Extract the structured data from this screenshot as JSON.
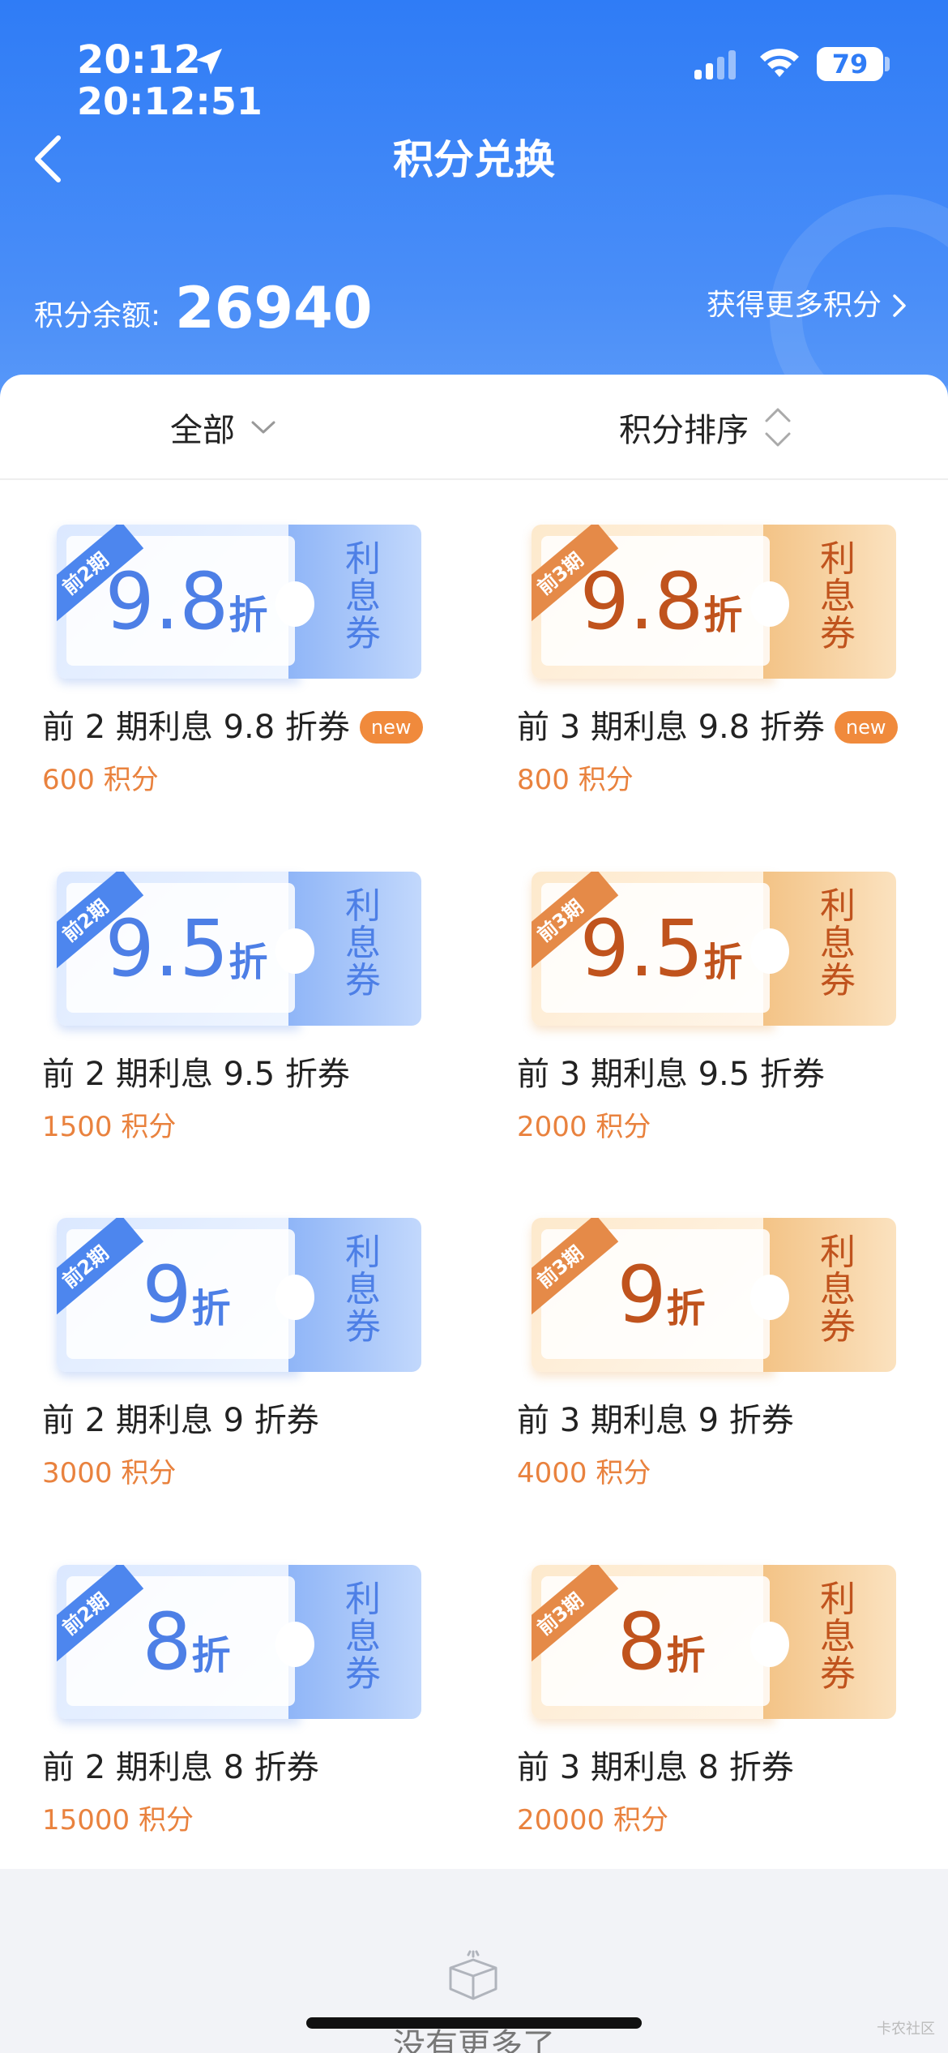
{
  "status": {
    "time": "20:12",
    "time_detail": "20:12:51",
    "battery": "79"
  },
  "nav": {
    "title": "积分兑换"
  },
  "balance": {
    "label": "积分余额:",
    "value": "26940",
    "more_link": "获得更多积分"
  },
  "filters": {
    "category": "全部",
    "sort": "积分排序"
  },
  "side_text": [
    "利",
    "息",
    "券"
  ],
  "coupons": [
    {
      "ribbon": "前2期",
      "num": "9.8",
      "zhe": "折",
      "title": "前 2 期利息 9.8 折券",
      "badge": "new",
      "cost": "600 积分",
      "theme": "blue"
    },
    {
      "ribbon": "前3期",
      "num": "9.8",
      "zhe": "折",
      "title": "前 3 期利息 9.8 折券",
      "badge": "new",
      "cost": "800 积分",
      "theme": "orange"
    },
    {
      "ribbon": "前2期",
      "num": "9.5",
      "zhe": "折",
      "title": "前 2 期利息 9.5 折券",
      "badge": "",
      "cost": "1500 积分",
      "theme": "blue"
    },
    {
      "ribbon": "前3期",
      "num": "9.5",
      "zhe": "折",
      "title": "前 3 期利息 9.5 折券",
      "badge": "",
      "cost": "2000 积分",
      "theme": "orange"
    },
    {
      "ribbon": "前2期",
      "num": "9",
      "zhe": "折",
      "title": "前 2 期利息 9 折券",
      "badge": "",
      "cost": "3000 积分",
      "theme": "blue"
    },
    {
      "ribbon": "前3期",
      "num": "9",
      "zhe": "折",
      "title": "前 3 期利息 9 折券",
      "badge": "",
      "cost": "4000 积分",
      "theme": "orange"
    },
    {
      "ribbon": "前2期",
      "num": "8",
      "zhe": "折",
      "title": "前 2 期利息 8 折券",
      "badge": "",
      "cost": "15000 积分",
      "theme": "blue"
    },
    {
      "ribbon": "前3期",
      "num": "8",
      "zhe": "折",
      "title": "前 3 期利息 8 折券",
      "badge": "",
      "cost": "20000 积分",
      "theme": "orange"
    }
  ],
  "footer": {
    "text": "没有更多了",
    "watermark": "卡农社区"
  }
}
